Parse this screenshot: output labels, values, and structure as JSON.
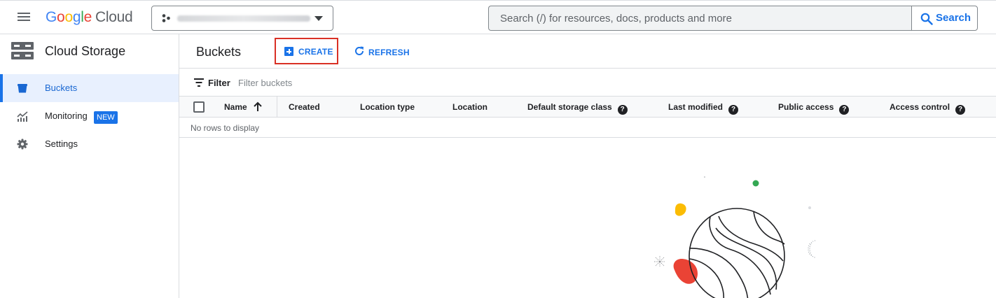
{
  "topbar": {
    "logo": {
      "letters": [
        "G",
        "o",
        "o",
        "g",
        "l",
        "e"
      ],
      "product": "Cloud"
    },
    "project_name": "",
    "search_placeholder": "Search (/) for resources, docs, products and more",
    "search_button": "Search"
  },
  "sidebar": {
    "title": "Cloud Storage",
    "items": [
      {
        "label": "Buckets",
        "icon": "bucket-icon",
        "active": true
      },
      {
        "label": "Monitoring",
        "icon": "monitoring-chart-icon",
        "badge": "NEW"
      },
      {
        "label": "Settings",
        "icon": "gear-icon"
      }
    ]
  },
  "main": {
    "title": "Buckets",
    "create_label": "CREATE",
    "refresh_label": "REFRESH",
    "filter_label": "Filter",
    "filter_placeholder": "Filter buckets",
    "columns": [
      {
        "label": "Name",
        "sorted": "ascending"
      },
      {
        "label": "Created"
      },
      {
        "label": "Location type"
      },
      {
        "label": "Location"
      },
      {
        "label": "Default storage class",
        "help": true
      },
      {
        "label": "Last modified",
        "help": true
      },
      {
        "label": "Public access",
        "help": true
      },
      {
        "label": "Access control",
        "help": true
      }
    ],
    "empty_message": "No rows to display"
  },
  "colors": {
    "accent": "#1a73e8",
    "highlight_border": "#d93025",
    "active_nav_bg": "#e8f0fe",
    "illustration_yellow": "#fbbc04",
    "illustration_red": "#ea4335",
    "illustration_green": "#34a853"
  }
}
